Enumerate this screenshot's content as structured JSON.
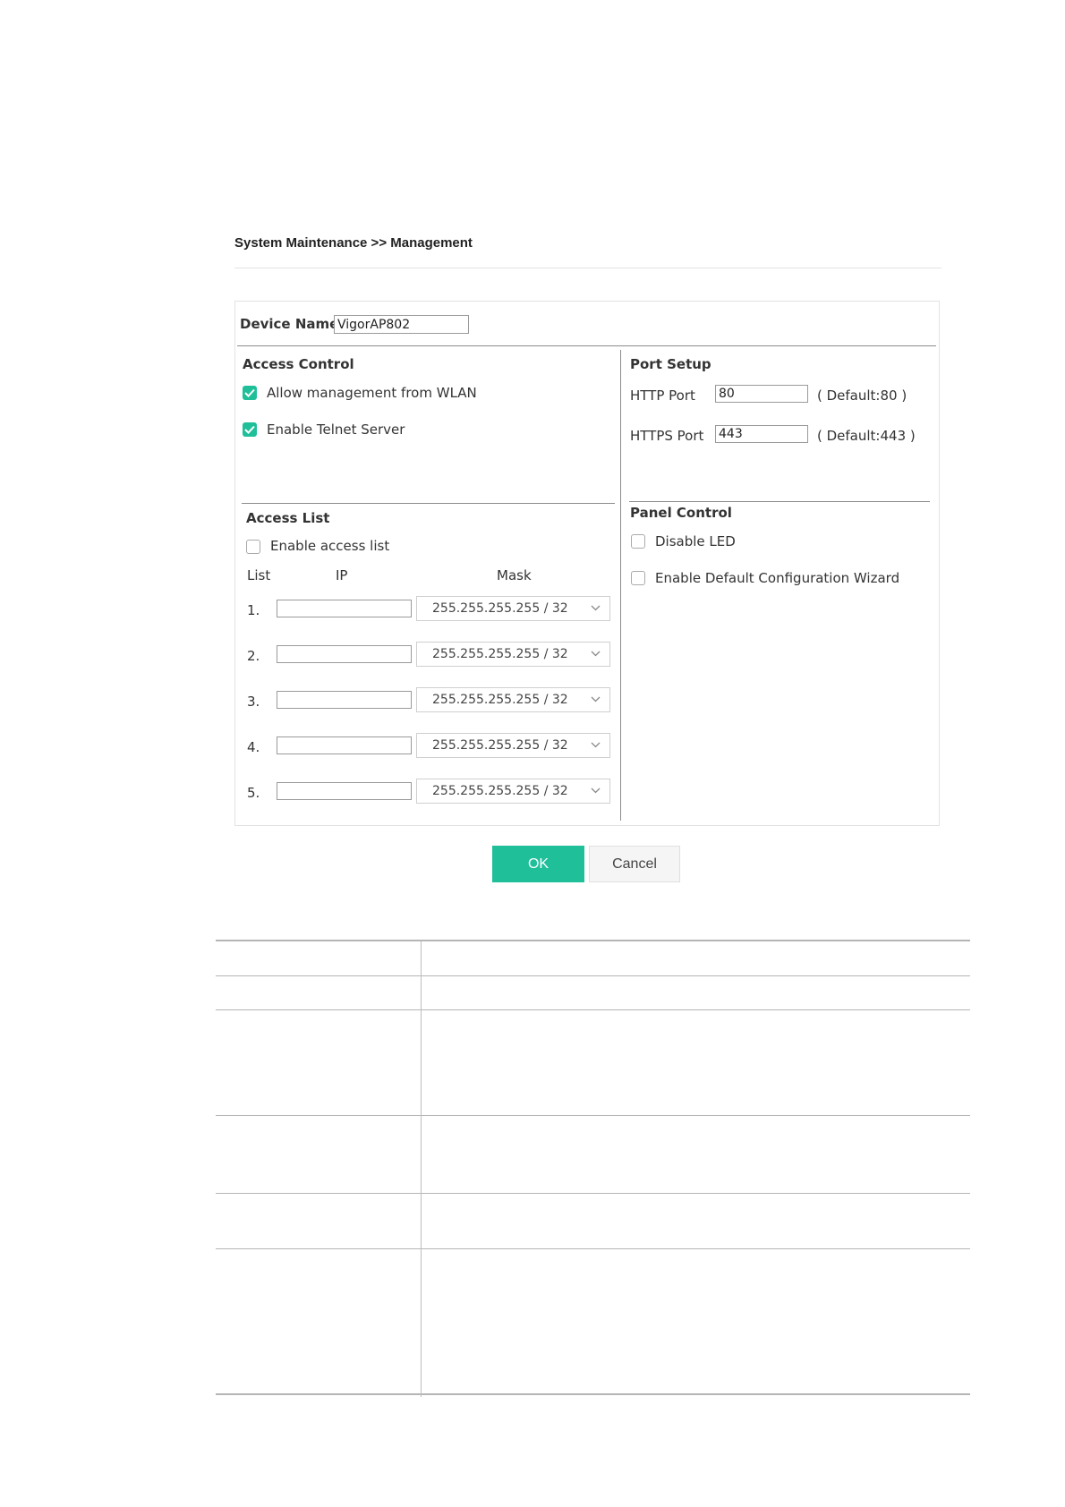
{
  "breadcrumb": "System Maintenance >> Management",
  "device": {
    "label": "Device Name",
    "value": "VigorAP802"
  },
  "access_control": {
    "title": "Access Control",
    "options": [
      {
        "label": "Allow management from WLAN",
        "checked": true
      },
      {
        "label": "Enable Telnet Server",
        "checked": true
      }
    ]
  },
  "port_setup": {
    "title": "Port Setup",
    "http": {
      "label": "HTTP Port",
      "value": "80",
      "default": "( Default:80 )"
    },
    "https": {
      "label": "HTTPS Port",
      "value": "443",
      "default": "( Default:443 )"
    }
  },
  "access_list": {
    "title": "Access List",
    "enable_label": "Enable access list",
    "enabled": false,
    "headers": {
      "list": "List",
      "ip": "IP",
      "mask": "Mask"
    },
    "rows": [
      {
        "num": "1.",
        "ip": "",
        "mask": "255.255.255.255 / 32"
      },
      {
        "num": "2.",
        "ip": "",
        "mask": "255.255.255.255 / 32"
      },
      {
        "num": "3.",
        "ip": "",
        "mask": "255.255.255.255 / 32"
      },
      {
        "num": "4.",
        "ip": "",
        "mask": "255.255.255.255 / 32"
      },
      {
        "num": "5.",
        "ip": "",
        "mask": "255.255.255.255 / 32"
      }
    ]
  },
  "panel_control": {
    "title": "Panel Control",
    "options": [
      {
        "label": "Disable LED",
        "checked": false
      },
      {
        "label": "Enable Default Configuration Wizard",
        "checked": false
      }
    ]
  },
  "buttons": {
    "ok": "OK",
    "cancel": "Cancel"
  },
  "colors": {
    "accent": "#1fbf9a",
    "line": "#8c8c8c"
  },
  "icons": {
    "checked": "checkmark-icon",
    "dropdown": "chevron-down-icon"
  }
}
